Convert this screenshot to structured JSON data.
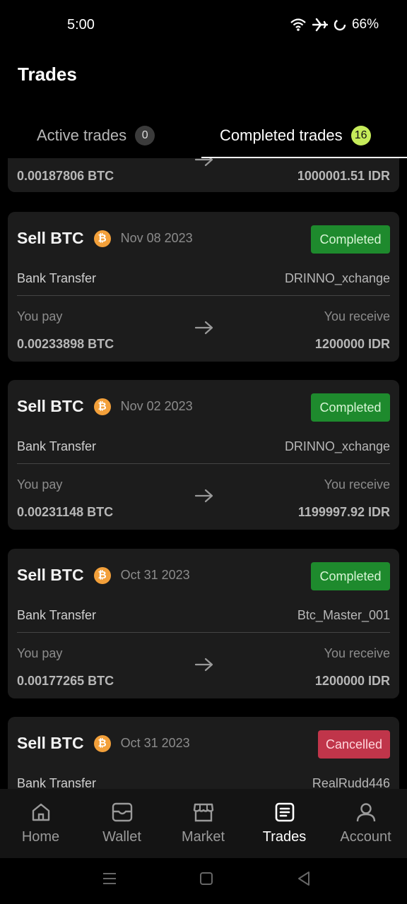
{
  "status_bar": {
    "time": "5:00",
    "battery": "66%"
  },
  "header": {
    "title": "Trades"
  },
  "tabs": [
    {
      "label": "Active trades",
      "count": "0"
    },
    {
      "label": "Completed trades",
      "count": "16"
    }
  ],
  "partial_card": {
    "pay_amount": "0.00187806 BTC",
    "receive_amount": "1000001.51 IDR"
  },
  "trades": [
    {
      "title": "Sell BTC",
      "coin_icon": "bitcoin-icon",
      "date": "Nov 08 2023",
      "status": "Completed",
      "method": "Bank Transfer",
      "counterparty": "DRINNO_xchange",
      "you_pay_label": "You pay",
      "you_receive_label": "You receive",
      "pay_amount": "0.00233898 BTC",
      "receive_amount": "1200000 IDR"
    },
    {
      "title": "Sell BTC",
      "coin_icon": "bitcoin-icon",
      "date": "Nov 02 2023",
      "status": "Completed",
      "method": "Bank Transfer",
      "counterparty": "DRINNO_xchange",
      "you_pay_label": "You pay",
      "you_receive_label": "You receive",
      "pay_amount": "0.00231148 BTC",
      "receive_amount": "1199997.92 IDR"
    },
    {
      "title": "Sell BTC",
      "coin_icon": "bitcoin-icon",
      "date": "Oct 31 2023",
      "status": "Completed",
      "method": "Bank Transfer",
      "counterparty": "Btc_Master_001",
      "you_pay_label": "You pay",
      "you_receive_label": "You receive",
      "pay_amount": "0.00177265 BTC",
      "receive_amount": "1200000 IDR"
    },
    {
      "title": "Sell BTC",
      "coin_icon": "bitcoin-icon",
      "date": "Oct 31 2023",
      "status": "Cancelled",
      "method": "Bank Transfer",
      "counterparty": "RealRudd446"
    }
  ],
  "bottom_nav": [
    {
      "label": "Home",
      "icon": "home-icon"
    },
    {
      "label": "Wallet",
      "icon": "wallet-icon"
    },
    {
      "label": "Market",
      "icon": "market-icon"
    },
    {
      "label": "Trades",
      "icon": "trades-icon",
      "active": true
    },
    {
      "label": "Account",
      "icon": "account-icon"
    }
  ],
  "colors": {
    "completed": "#1e8a2d",
    "cancelled": "#c0354a",
    "badge_accent": "#c6ec5a",
    "bitcoin": "#f3a03a"
  }
}
